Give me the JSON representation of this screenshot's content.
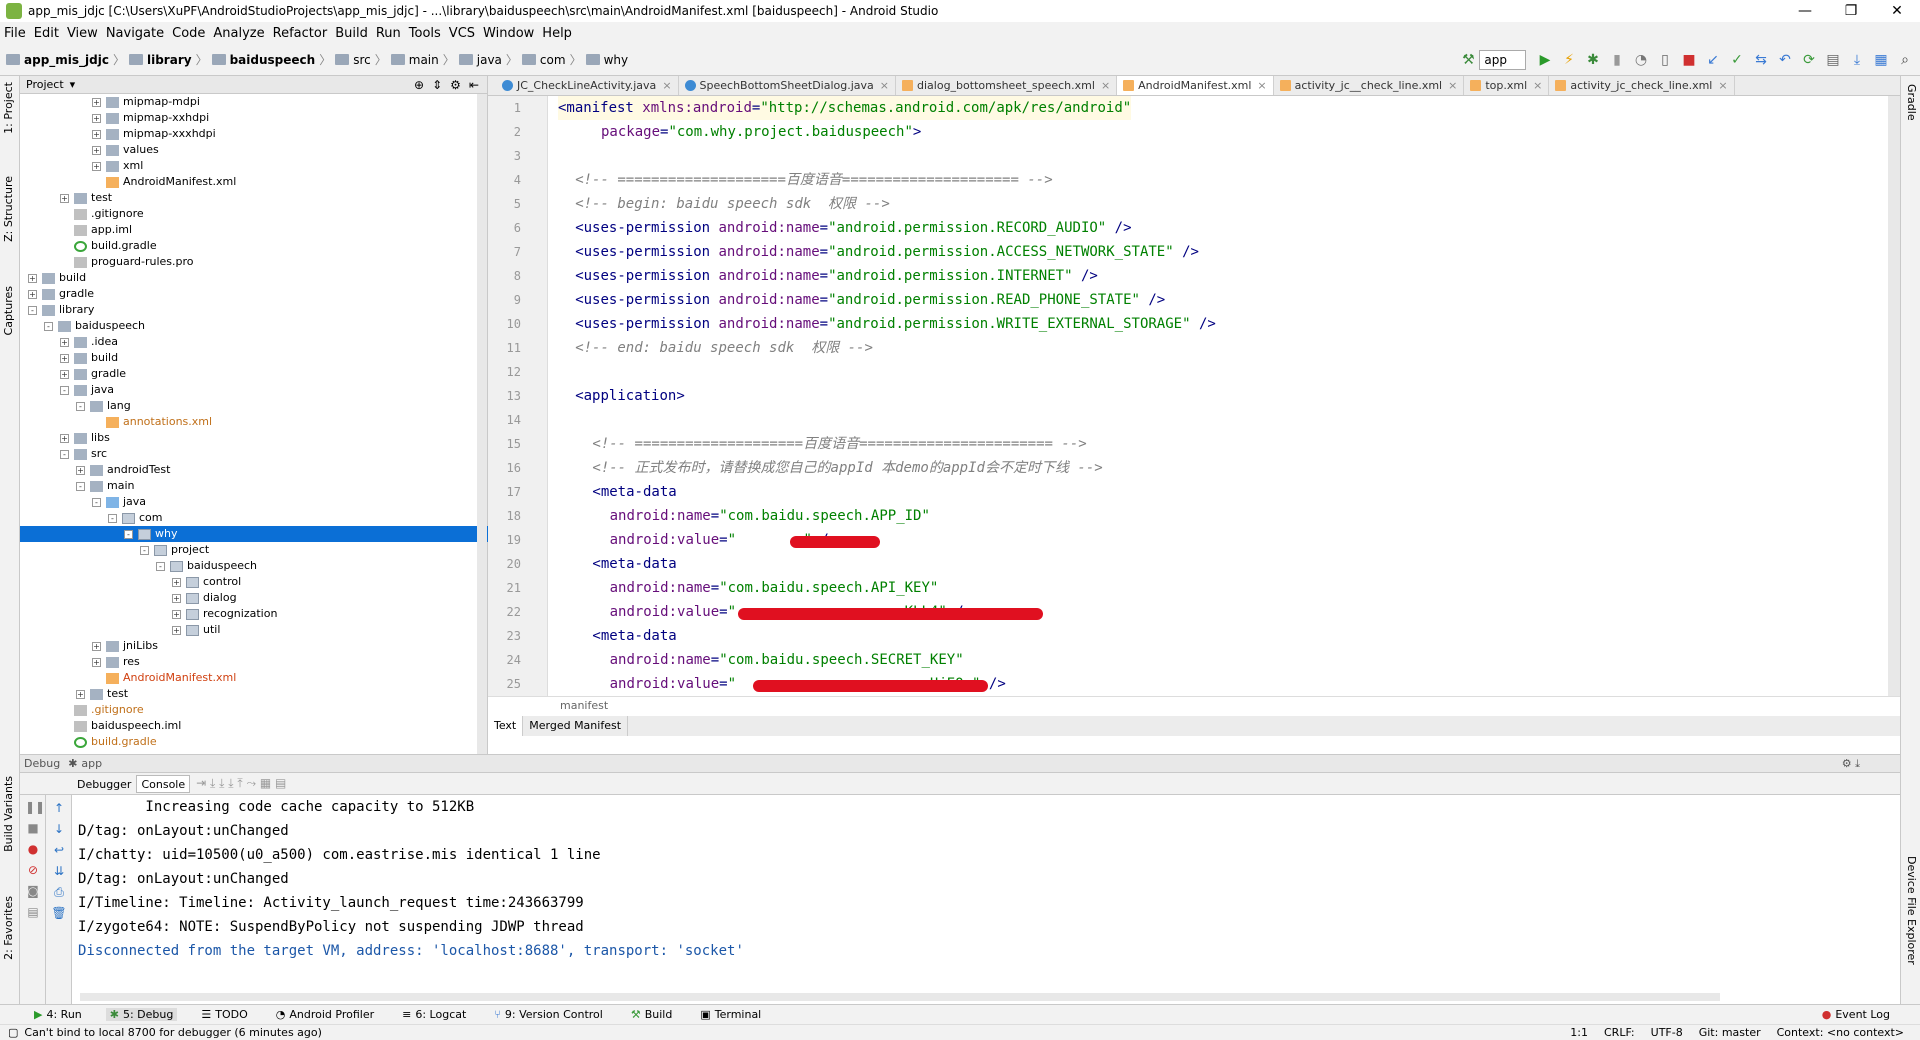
{
  "window": {
    "title": "app_mis_jdjc [C:\\Users\\XuPF\\AndroidStudioProjects\\app_mis_jdjc] - ...\\library\\baiduspeech\\src\\main\\AndroidManifest.xml [baiduspeech] - Android Studio",
    "minimize": "—",
    "maximize": "❐",
    "close": "✕"
  },
  "menu": [
    "File",
    "Edit",
    "View",
    "Navigate",
    "Code",
    "Analyze",
    "Refactor",
    "Build",
    "Run",
    "Tools",
    "VCS",
    "Window",
    "Help"
  ],
  "breadcrumbs": [
    "app_mis_jdjc",
    "library",
    "baiduspeech",
    "src",
    "main",
    "java",
    "com",
    "why"
  ],
  "toolbar": {
    "run_config": "app"
  },
  "project_panel": {
    "title": "Project"
  },
  "tree": [
    {
      "label": "mipmap-mdpi",
      "level": 5,
      "icon": "folder",
      "exp": "+"
    },
    {
      "label": "mipmap-xxhdpi",
      "level": 5,
      "icon": "folder",
      "exp": "+"
    },
    {
      "label": "mipmap-xxxhdpi",
      "level": 5,
      "icon": "folder",
      "exp": "+"
    },
    {
      "label": "values",
      "level": 5,
      "icon": "folder",
      "exp": "+"
    },
    {
      "label": "xml",
      "level": 5,
      "icon": "folder",
      "exp": "+"
    },
    {
      "label": "AndroidManifest.xml",
      "level": 5,
      "icon": "xml",
      "exp": ""
    },
    {
      "label": "test",
      "level": 3,
      "icon": "folder",
      "exp": "+"
    },
    {
      "label": ".gitignore",
      "level": 3,
      "icon": "file",
      "exp": ""
    },
    {
      "label": "app.iml",
      "level": 3,
      "icon": "file",
      "exp": ""
    },
    {
      "label": "build.gradle",
      "level": 3,
      "icon": "gradle",
      "exp": ""
    },
    {
      "label": "proguard-rules.pro",
      "level": 3,
      "icon": "file",
      "exp": ""
    },
    {
      "label": "build",
      "level": 1,
      "icon": "folder",
      "exp": "+"
    },
    {
      "label": "gradle",
      "level": 1,
      "icon": "folder",
      "exp": "+"
    },
    {
      "label": "library",
      "level": 1,
      "icon": "folder",
      "exp": "-"
    },
    {
      "label": "baiduspeech",
      "level": 2,
      "icon": "folder",
      "exp": "-"
    },
    {
      "label": ".idea",
      "level": 3,
      "icon": "folder",
      "exp": "+"
    },
    {
      "label": "build",
      "level": 3,
      "icon": "folder",
      "exp": "+"
    },
    {
      "label": "gradle",
      "level": 3,
      "icon": "folder",
      "exp": "+"
    },
    {
      "label": "java",
      "level": 3,
      "icon": "folder",
      "exp": "-"
    },
    {
      "label": "lang",
      "level": 4,
      "icon": "folder",
      "exp": "-"
    },
    {
      "label": "annotations.xml",
      "level": 5,
      "icon": "xml",
      "exp": "",
      "color": "orange"
    },
    {
      "label": "libs",
      "level": 3,
      "icon": "folder",
      "exp": "+"
    },
    {
      "label": "src",
      "level": 3,
      "icon": "folder",
      "exp": "-"
    },
    {
      "label": "androidTest",
      "level": 4,
      "icon": "folder",
      "exp": "+"
    },
    {
      "label": "main",
      "level": 4,
      "icon": "folder",
      "exp": "-"
    },
    {
      "label": "java",
      "level": 5,
      "icon": "srcfolder",
      "exp": "-"
    },
    {
      "label": "com",
      "level": 6,
      "icon": "pkg",
      "exp": "-"
    },
    {
      "label": "why",
      "level": 7,
      "icon": "pkg",
      "exp": "-",
      "selected": true
    },
    {
      "label": "project",
      "level": 8,
      "icon": "pkg",
      "exp": "-"
    },
    {
      "label": "baiduspeech",
      "level": 9,
      "icon": "pkg",
      "exp": "-"
    },
    {
      "label": "control",
      "level": 10,
      "icon": "pkg",
      "exp": "+"
    },
    {
      "label": "dialog",
      "level": 10,
      "icon": "pkg",
      "exp": "+"
    },
    {
      "label": "recognization",
      "level": 10,
      "icon": "pkg",
      "exp": "+"
    },
    {
      "label": "util",
      "level": 10,
      "icon": "pkg",
      "exp": "+"
    },
    {
      "label": "jniLibs",
      "level": 5,
      "icon": "folder",
      "exp": "+"
    },
    {
      "label": "res",
      "level": 5,
      "icon": "folder",
      "exp": "+"
    },
    {
      "label": "AndroidManifest.xml",
      "level": 5,
      "icon": "xml",
      "exp": "",
      "color": "red"
    },
    {
      "label": "test",
      "level": 4,
      "icon": "folder",
      "exp": "+"
    },
    {
      "label": ".gitignore",
      "level": 3,
      "icon": "file",
      "exp": "",
      "color": "orange"
    },
    {
      "label": "baiduspeech.iml",
      "level": 3,
      "icon": "file",
      "exp": ""
    },
    {
      "label": "build.gradle",
      "level": 3,
      "icon": "gradle",
      "exp": "",
      "color": "orange"
    }
  ],
  "editor_tabs": [
    {
      "label": "JC_CheckLineActivity.java",
      "kind": "java"
    },
    {
      "label": "SpeechBottomSheetDialog.java",
      "kind": "java"
    },
    {
      "label": "dialog_bottomsheet_speech.xml",
      "kind": "xml"
    },
    {
      "label": "AndroidManifest.xml",
      "kind": "xml",
      "active": true
    },
    {
      "label": "activity_jc__check_line.xml",
      "kind": "xml"
    },
    {
      "label": "top.xml",
      "kind": "xml"
    },
    {
      "label": "activity_jc_check_line.xml",
      "kind": "xml"
    }
  ],
  "code_lines": [
    {
      "n": "1",
      "indent": 0,
      "parts": [
        [
          "tag",
          "<manifest "
        ],
        [
          "attr",
          "xmlns:android"
        ],
        [
          "tag",
          "="
        ],
        [
          "val",
          "\"http://schemas.android.com/apk/res/android\""
        ]
      ]
    },
    {
      "n": "2",
      "indent": 5,
      "parts": [
        [
          "attr",
          "package"
        ],
        [
          "tag",
          "="
        ],
        [
          "val",
          "\"com.why.project.baiduspeech\""
        ],
        [
          "tag",
          ">"
        ]
      ]
    },
    {
      "n": "3",
      "indent": 0,
      "parts": []
    },
    {
      "n": "4",
      "indent": 2,
      "parts": [
        [
          "cmt",
          "<!-- ====================百度语音===================== -->"
        ]
      ]
    },
    {
      "n": "5",
      "indent": 2,
      "parts": [
        [
          "cmt",
          "<!-- begin: baidu speech sdk  权限 -->"
        ]
      ]
    },
    {
      "n": "6",
      "indent": 2,
      "parts": [
        [
          "tag",
          "<uses-permission "
        ],
        [
          "attr",
          "android:name"
        ],
        [
          "tag",
          "="
        ],
        [
          "val",
          "\"android.permission.RECORD_AUDIO\""
        ],
        [
          "tag",
          " />"
        ]
      ]
    },
    {
      "n": "7",
      "indent": 2,
      "parts": [
        [
          "tag",
          "<uses-permission "
        ],
        [
          "attr",
          "android:name"
        ],
        [
          "tag",
          "="
        ],
        [
          "val",
          "\"android.permission.ACCESS_NETWORK_STATE\""
        ],
        [
          "tag",
          " />"
        ]
      ]
    },
    {
      "n": "8",
      "indent": 2,
      "parts": [
        [
          "tag",
          "<uses-permission "
        ],
        [
          "attr",
          "android:name"
        ],
        [
          "tag",
          "="
        ],
        [
          "val",
          "\"android.permission.INTERNET\""
        ],
        [
          "tag",
          " />"
        ]
      ]
    },
    {
      "n": "9",
      "indent": 2,
      "parts": [
        [
          "tag",
          "<uses-permission "
        ],
        [
          "attr",
          "android:name"
        ],
        [
          "tag",
          "="
        ],
        [
          "val",
          "\"android.permission.READ_PHONE_STATE\""
        ],
        [
          "tag",
          " />"
        ]
      ]
    },
    {
      "n": "10",
      "indent": 2,
      "parts": [
        [
          "tag",
          "<uses-permission "
        ],
        [
          "attr",
          "android:name"
        ],
        [
          "tag",
          "="
        ],
        [
          "val",
          "\"android.permission.WRITE_EXTERNAL_STORAGE\""
        ],
        [
          "tag",
          " />"
        ]
      ]
    },
    {
      "n": "11",
      "indent": 2,
      "parts": [
        [
          "cmt",
          "<!-- end: baidu speech sdk  权限 -->"
        ]
      ]
    },
    {
      "n": "12",
      "indent": 0,
      "parts": []
    },
    {
      "n": "13",
      "indent": 2,
      "parts": [
        [
          "tag",
          "<application>"
        ]
      ]
    },
    {
      "n": "14",
      "indent": 0,
      "parts": []
    },
    {
      "n": "15",
      "indent": 4,
      "parts": [
        [
          "cmt",
          "<!-- ====================百度语音======================= -->"
        ]
      ]
    },
    {
      "n": "16",
      "indent": 4,
      "parts": [
        [
          "cmt",
          "<!-- 正式发布时，请替换成您自己的appId 本demo的appId会不定时下线 -->"
        ]
      ]
    },
    {
      "n": "17",
      "indent": 4,
      "parts": [
        [
          "tag",
          "<meta-data"
        ]
      ]
    },
    {
      "n": "18",
      "indent": 6,
      "parts": [
        [
          "attr",
          "android:name"
        ],
        [
          "tag",
          "="
        ],
        [
          "val",
          "\"com.baidu.speech.APP_ID\""
        ]
      ]
    },
    {
      "n": "19",
      "indent": 6,
      "parts": [
        [
          "attr",
          "android:value"
        ],
        [
          "tag",
          "="
        ],
        [
          "val",
          "\"        \""
        ],
        [
          "tag",
          " />"
        ]
      ]
    },
    {
      "n": "20",
      "indent": 4,
      "parts": [
        [
          "tag",
          "<meta-data"
        ]
      ]
    },
    {
      "n": "21",
      "indent": 6,
      "parts": [
        [
          "attr",
          "android:name"
        ],
        [
          "tag",
          "="
        ],
        [
          "val",
          "\"com.baidu.speech.API_KEY\""
        ]
      ]
    },
    {
      "n": "22",
      "indent": 6,
      "parts": [
        [
          "attr",
          "android:value"
        ],
        [
          "tag",
          "="
        ],
        [
          "val",
          "\"                    KLL4\""
        ],
        [
          "tag",
          " />"
        ]
      ]
    },
    {
      "n": "23",
      "indent": 4,
      "parts": [
        [
          "tag",
          "<meta-data"
        ]
      ]
    },
    {
      "n": "24",
      "indent": 6,
      "parts": [
        [
          "attr",
          "android:name"
        ],
        [
          "tag",
          "="
        ],
        [
          "val",
          "\"com.baidu.speech.SECRET_KEY\""
        ]
      ]
    },
    {
      "n": "25",
      "indent": 6,
      "parts": [
        [
          "attr",
          "android:value"
        ],
        [
          "tag",
          "="
        ],
        [
          "val",
          "\"                     pcUjEO \""
        ],
        [
          "tag",
          " />"
        ]
      ]
    }
  ],
  "editor_breadcrumb": "manifest",
  "editor_bottom_tabs": [
    "Text",
    "Merged Manifest"
  ],
  "debug": {
    "header_debug": "Debug",
    "header_app": "app",
    "tab_debugger": "Debugger",
    "tab_console": "Console",
    "console_lines": [
      {
        "text": "        Increasing code cache capacity to 512KB",
        "color": "black"
      },
      {
        "text": "D/tag: onLayout:unChanged",
        "color": "black"
      },
      {
        "text": "I/chatty: uid=10500(u0_a500) com.eastrise.mis identical 1 line",
        "color": "black"
      },
      {
        "text": "D/tag: onLayout:unChanged",
        "color": "black"
      },
      {
        "text": "I/Timeline: Timeline: Activity_launch_request time:243663799",
        "color": "black"
      },
      {
        "text": "I/zygote64: NOTE: SuspendByPolicy not suspending JDWP thread",
        "color": "black"
      },
      {
        "text": "Disconnected from the target VM, address: 'localhost:8688', transport: 'socket'",
        "color": "blue"
      }
    ]
  },
  "bottom_tool_tabs": [
    "4: Run",
    "5: Debug",
    "TODO",
    "Android Profiler",
    "6: Logcat",
    "9: Version Control",
    "Build",
    "Terminal"
  ],
  "event_log": "Event Log",
  "status": {
    "message": "Can't bind to local 8700 for debugger (6 minutes ago)",
    "position": "1:1",
    "line_sep": "CRLF:",
    "encoding": "UTF-8",
    "git": "Git: master",
    "context": "Context: <no context>"
  },
  "side_tabs": {
    "left": [
      "1: Project",
      "Z: Structure",
      "Captures",
      "Build Variants",
      "2: Favorites"
    ],
    "right": [
      "Gradle",
      "Device File Explorer"
    ]
  },
  "colors": {
    "selection": "#0b6fd6",
    "tag": "#000080",
    "attr": "#660e7a",
    "value": "#008000",
    "comment": "#808080",
    "redaction": "#e01020"
  }
}
